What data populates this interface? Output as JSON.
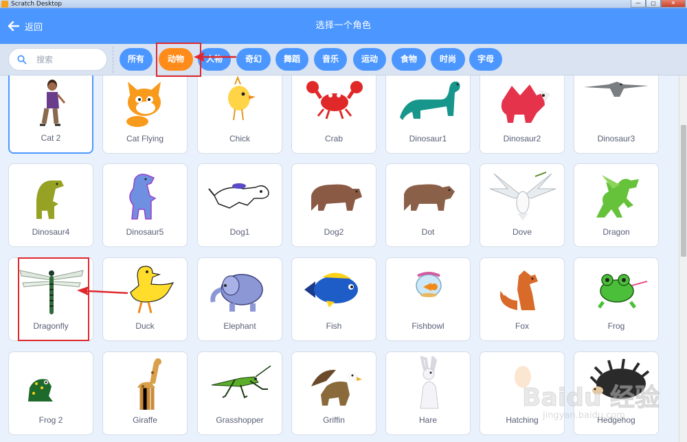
{
  "window": {
    "title": "Scratch Desktop",
    "minimize": "—",
    "maximize": "▢",
    "close": "✕"
  },
  "header": {
    "back_label": "返回",
    "title": "选择一个角色"
  },
  "search": {
    "placeholder": "搜索"
  },
  "tags": [
    "所有",
    "动物",
    "人物",
    "奇幻",
    "舞蹈",
    "音乐",
    "运动",
    "食物",
    "时尚",
    "字母"
  ],
  "active_tag": "动物",
  "sprites": [
    "Cat 2",
    "Cat Flying",
    "Chick",
    "Crab",
    "Dinosaur1",
    "Dinosaur2",
    "Dinosaur3",
    "Dinosaur4",
    "Dinosaur5",
    "Dog1",
    "Dog2",
    "Dot",
    "Dove",
    "Dragon",
    "Dragonfly",
    "Duck",
    "Elephant",
    "Fish",
    "Fishbowl",
    "Fox",
    "Frog",
    "Frog 2",
    "Giraffe",
    "Grasshopper",
    "Griffin",
    "Hare",
    "Hatching",
    "Hedgehog"
  ],
  "selected_sprite": "Cat 2",
  "watermark": {
    "main": "Baidu 经验",
    "sub": "jingyan.baidu.com"
  },
  "colors": {
    "header": "#4c97ff",
    "active_tag": "#ff8c1a",
    "highlight": "#e0262a"
  }
}
